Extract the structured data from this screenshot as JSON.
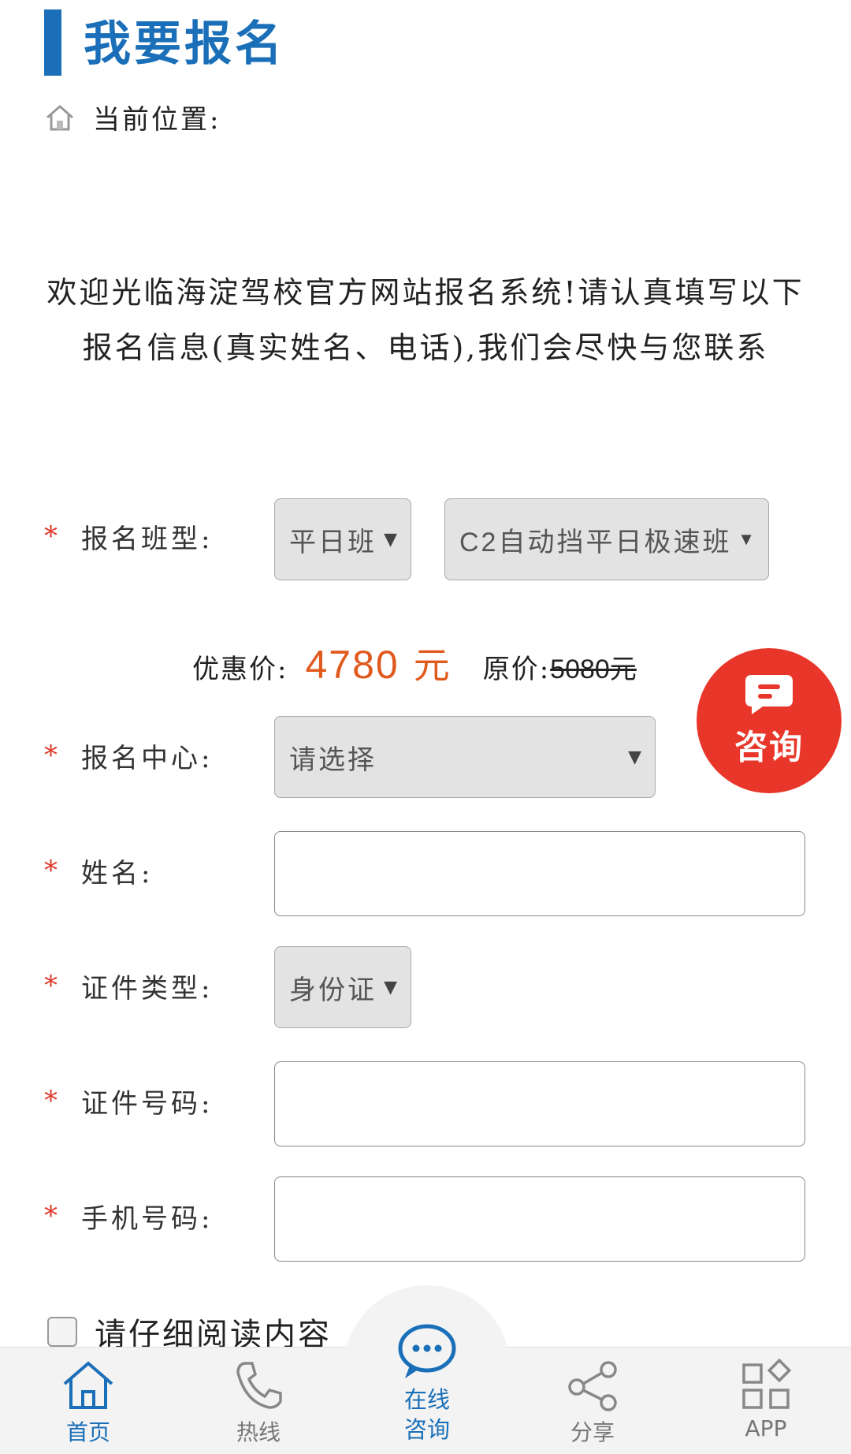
{
  "header": {
    "title": "我要报名"
  },
  "breadcrumb": {
    "label": "当前位置:",
    "icon": "home-icon"
  },
  "intro": "欢迎光临海淀驾校官方网站报名系统!请认真填写以下报名信息(真实姓名、电话),我们会尽快与您联系",
  "form": {
    "required_mark": "*",
    "class_type": {
      "label": "报名班型:",
      "schedule": "平日班",
      "class": "C2自动挡平日极速班"
    },
    "price": {
      "discount_label": "优惠价:",
      "discount_value": "4780",
      "currency": "元",
      "original_label": "原价:",
      "original_value": "5080元"
    },
    "center": {
      "label": "报名中心:",
      "value": "请选择"
    },
    "name": {
      "label": "姓名:",
      "value": ""
    },
    "id_type": {
      "label": "证件类型:",
      "value": "身份证"
    },
    "id_number": {
      "label": "证件号码:",
      "value": ""
    },
    "phone": {
      "label": "手机号码:",
      "value": ""
    },
    "agree_text": "请仔细阅读内容"
  },
  "consult_button": {
    "label": "咨询",
    "color": "#e8372a"
  },
  "tabbar": {
    "items": [
      {
        "label": "首页",
        "icon": "home-icon",
        "active": true
      },
      {
        "label": "热线",
        "icon": "phone-icon"
      },
      {
        "label": "在线咨询",
        "icon": "chat-icon"
      },
      {
        "label": "分享",
        "icon": "share-icon"
      },
      {
        "label": "APP",
        "icon": "app-grid-icon"
      }
    ]
  },
  "colors": {
    "accent": "#1a6fb8",
    "price": "#e05a1e",
    "required": "#e0392b"
  }
}
